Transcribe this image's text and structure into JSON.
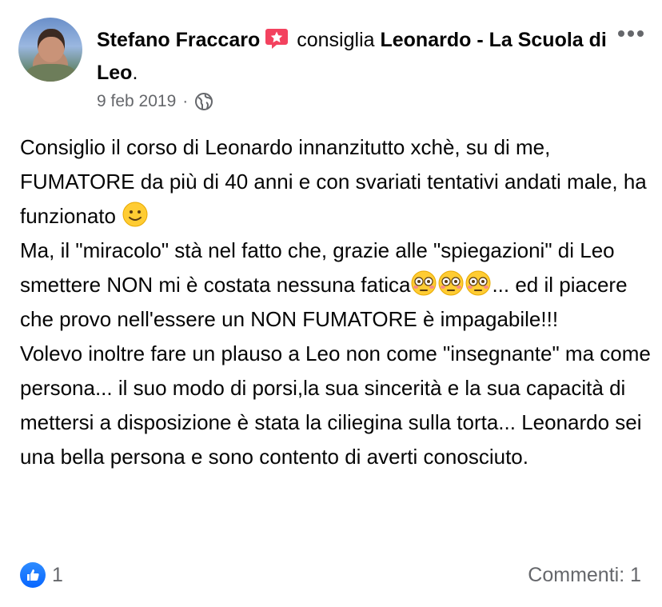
{
  "post": {
    "author": "Stefano Fraccaro",
    "action": "consiglia",
    "page_name": "Leonardo - La Scuola di Leo",
    "page_suffix": ".",
    "date": "9 feb 2019",
    "separator": "·",
    "privacy_icon": "globe-icon",
    "verified_icon": "recommend-badge-icon",
    "paragraphs": {
      "p1": "Consiglio il corso di Leonardo innanzitutto xchè, su di me, FUMATORE da più di 40 anni e con svariati tentativi andati male, ha funzionato",
      "p2a": "Ma, il \"miracolo\" stà nel fatto che, grazie alle \"spiegazioni\" di Leo smettere NON mi è costata nessuna fatica",
      "p2b": "...  ed il piacere che provo nell'essere un NON FUMATORE è impagabile!!!",
      "p3": "Volevo inoltre fare un plauso a Leo non come \"insegnante\" ma come persona... il suo modo di porsi,la sua sincerità e la sua capacità di mettersi a disposizione è stata la ciliegina sulla torta... Leonardo sei una bella persona e sono contento di averti conosciuto."
    }
  },
  "footer": {
    "reaction_icon": "like-icon",
    "reaction_count": "1",
    "comments": "Commenti: 1"
  },
  "colors": {
    "text": "#050505",
    "muted": "#65676b",
    "like_blue": "#0866ff",
    "badge_pink": "#f3425f"
  }
}
